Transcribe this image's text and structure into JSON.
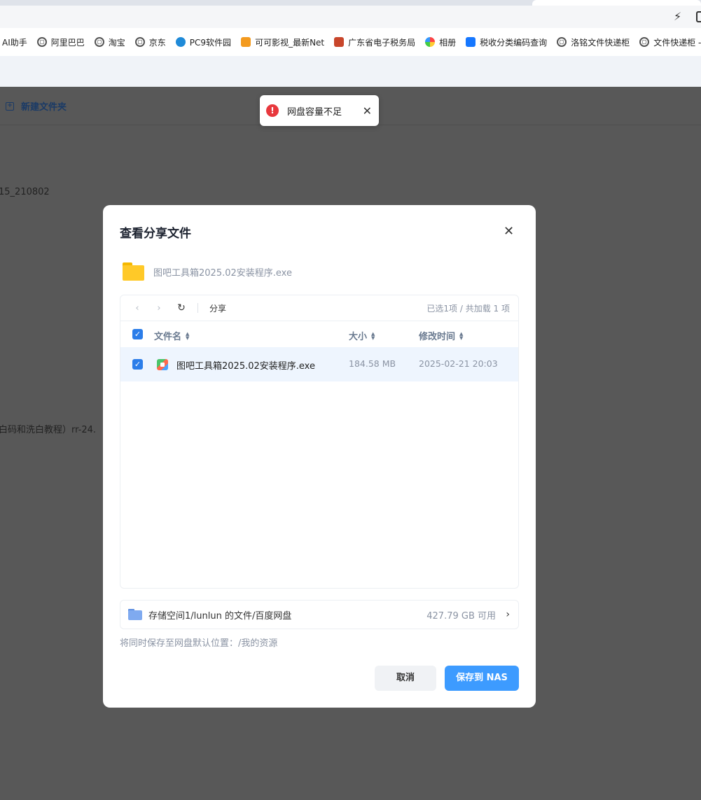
{
  "browser": {
    "bookmarks": [
      {
        "label": "AI助手",
        "icon": "none"
      },
      {
        "label": "阿里巴巴",
        "icon": "globe-icon"
      },
      {
        "label": "淘宝",
        "icon": "globe-icon"
      },
      {
        "label": "京东",
        "icon": "globe-icon"
      },
      {
        "label": "PC9软件园",
        "icon": "blue-circle-icon"
      },
      {
        "label": "可可影视_最新Net",
        "icon": "orange-logo-icon"
      },
      {
        "label": "广东省电子税务局",
        "icon": "tax-logo-icon"
      },
      {
        "label": "相册",
        "icon": "photos-icon"
      },
      {
        "label": "税收分类编码查询",
        "icon": "blue-square-icon"
      },
      {
        "label": "洛铭文件快递柜",
        "icon": "globe-icon"
      },
      {
        "label": "文件快递柜 - F",
        "icon": "globe-icon"
      }
    ],
    "bolt_icon": "⚡"
  },
  "page": {
    "new_folder_label": "新建文件夹",
    "row1_text": "15_210802",
    "row2_text": "白码和洗白教程）rr-24."
  },
  "toast": {
    "message": "网盘容量不足",
    "icon": "!",
    "close": "✕"
  },
  "modal": {
    "title": "查看分享文件",
    "close": "✕",
    "file_name": "图吧工具箱2025.02安装程序.exe",
    "nav": {
      "back": "‹",
      "forward": "›",
      "refresh": "↻",
      "breadcrumb": "分享",
      "count": "已选1项 / 共加载 1 项"
    },
    "columns": {
      "name": "文件名",
      "size": "大小",
      "modified": "修改时间"
    },
    "rows": [
      {
        "name": "图吧工具箱2025.02安装程序.exe",
        "size": "184.58 MB",
        "modified": "2025-02-21 20:03",
        "checked": true
      }
    ],
    "destination": {
      "path": "存储空间1/lunlun 的文件/百度网盘",
      "available": "427.79 GB 可用",
      "chevron": "›"
    },
    "note": "将同时保存至网盘默认位置：/我的资源",
    "cancel_label": "取消",
    "save_label": "保存到 NAS"
  },
  "colors": {
    "primary": "#3d9bff",
    "checkbox": "#2b7de9",
    "error": "#e8383d",
    "overlay": "#585858"
  }
}
